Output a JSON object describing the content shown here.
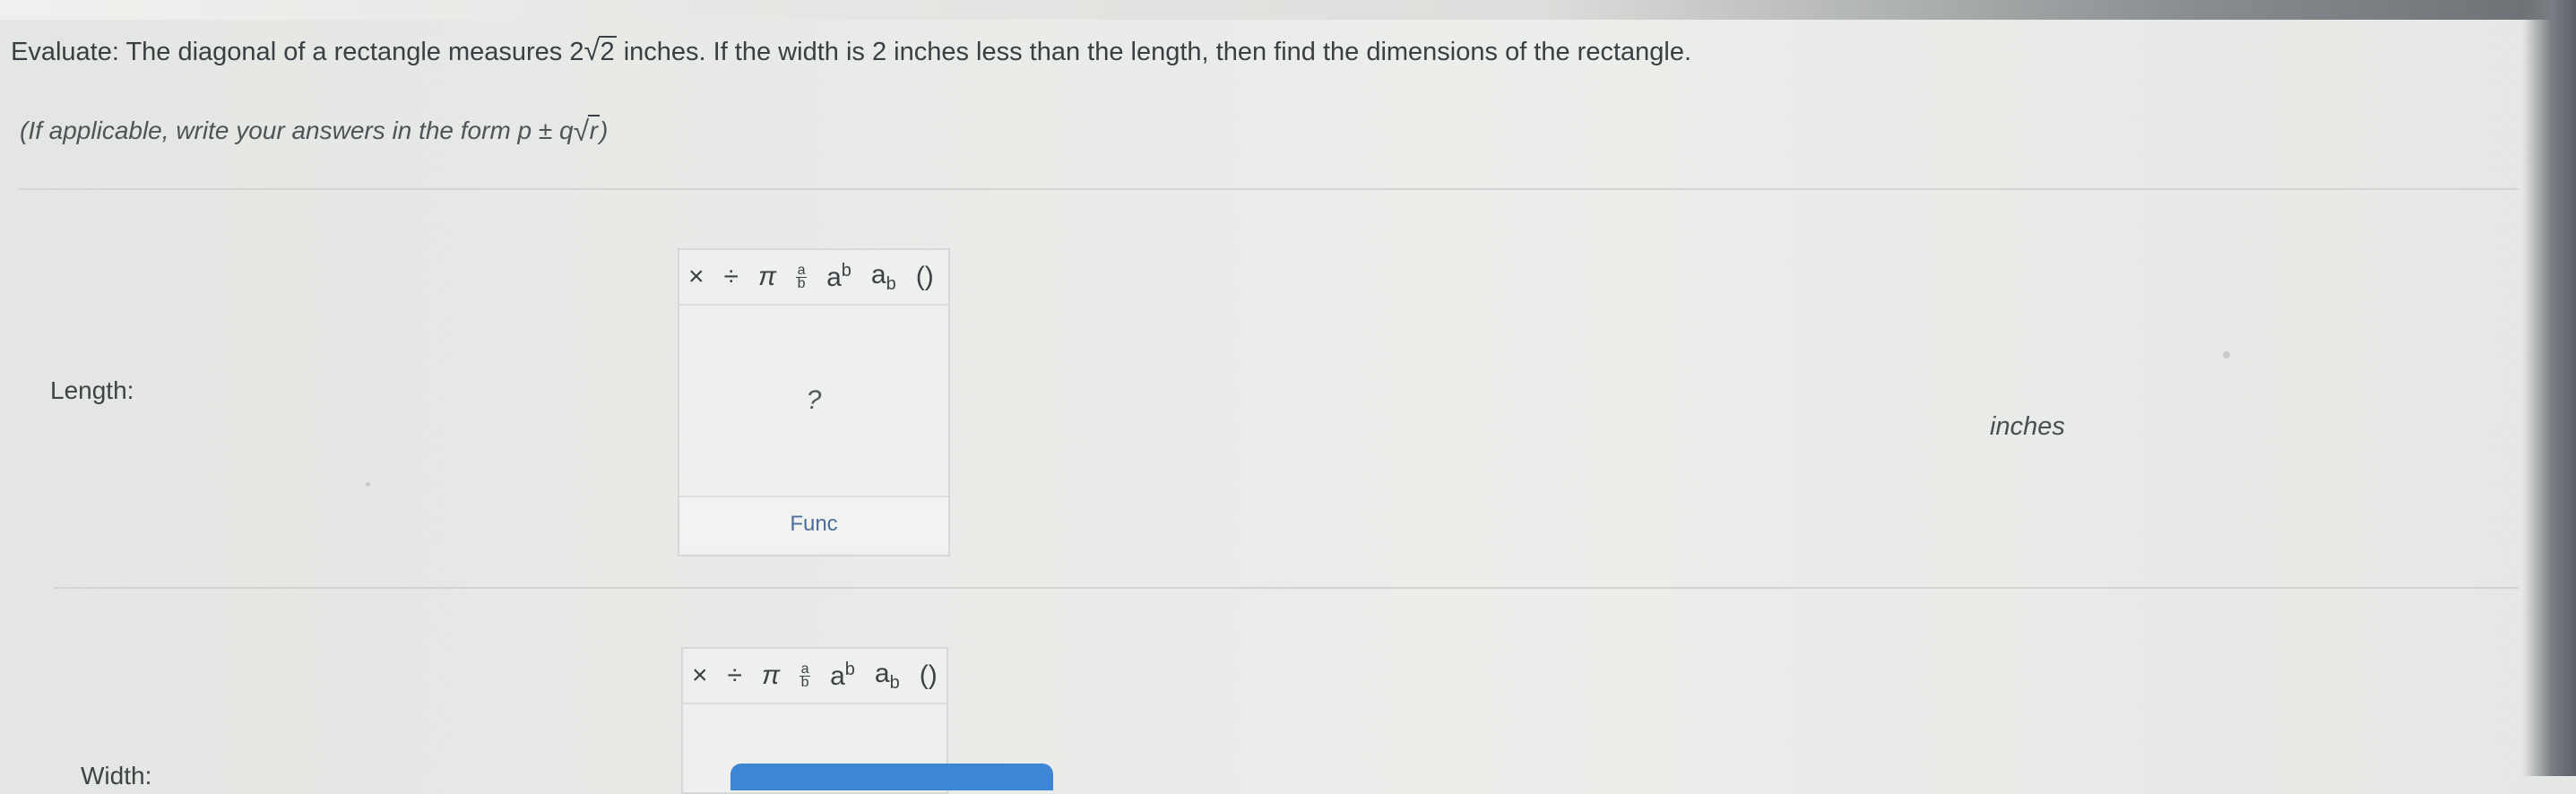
{
  "question": {
    "prompt_before": "Evaluate: The diagonal of a rectangle measures 2",
    "prompt_radicand": "2",
    "prompt_after": " inches. If the width is 2 inches less than the length, then find the dimensions of the rectangle.",
    "hint_before": "(If applicable, write your answers in the form p ± q",
    "hint_radicand": "r",
    "hint_after": ")"
  },
  "toolbar": {
    "times": "×",
    "divide": "÷",
    "pi": "π",
    "frac_num": "a",
    "frac_den": "b",
    "power_base": "a",
    "power_exp": "b",
    "sub_base": "a",
    "sub_idx": "b",
    "parens": "()"
  },
  "length_field": {
    "label": "Length:",
    "placeholder": "?",
    "func_label": "Func",
    "unit": "inches"
  },
  "width_field": {
    "label": "Width:"
  }
}
